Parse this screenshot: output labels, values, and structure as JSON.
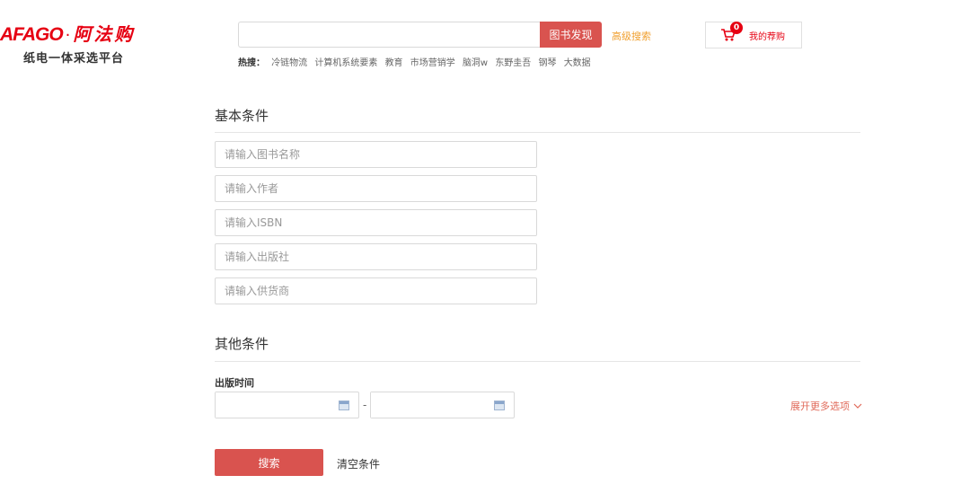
{
  "logo": {
    "brand_en": "AFAGO",
    "brand_cn": "阿法购",
    "dot": "·",
    "tagline": "纸电一体采选平台"
  },
  "search": {
    "value": "",
    "placeholder": "",
    "button_label": "图书发现",
    "advanced_label": "高级搜索"
  },
  "hot": {
    "label": "热搜：",
    "items": [
      "冷链物流",
      "计算机系统要素",
      "教育",
      "市场营销学",
      "脑洞w",
      "东野圭吾",
      "钢琴",
      "大数据"
    ]
  },
  "cart": {
    "count": "0",
    "label": "我的荐购"
  },
  "basic": {
    "title": "基本条件",
    "fields": [
      {
        "placeholder": "请输入图书名称"
      },
      {
        "placeholder": "请输入作者"
      },
      {
        "placeholder": "请输入ISBN"
      },
      {
        "placeholder": "请输入出版社"
      },
      {
        "placeholder": "请输入供货商"
      }
    ]
  },
  "other": {
    "title": "其他条件",
    "pub_time_label": "出版时间",
    "date_separator": "-",
    "expand_label": "展开更多选项"
  },
  "actions": {
    "search_label": "搜索",
    "clear_label": "清空条件"
  },
  "colors": {
    "accent": "#d9534f",
    "brand_red": "#e60012",
    "advanced": "#f0a030"
  }
}
